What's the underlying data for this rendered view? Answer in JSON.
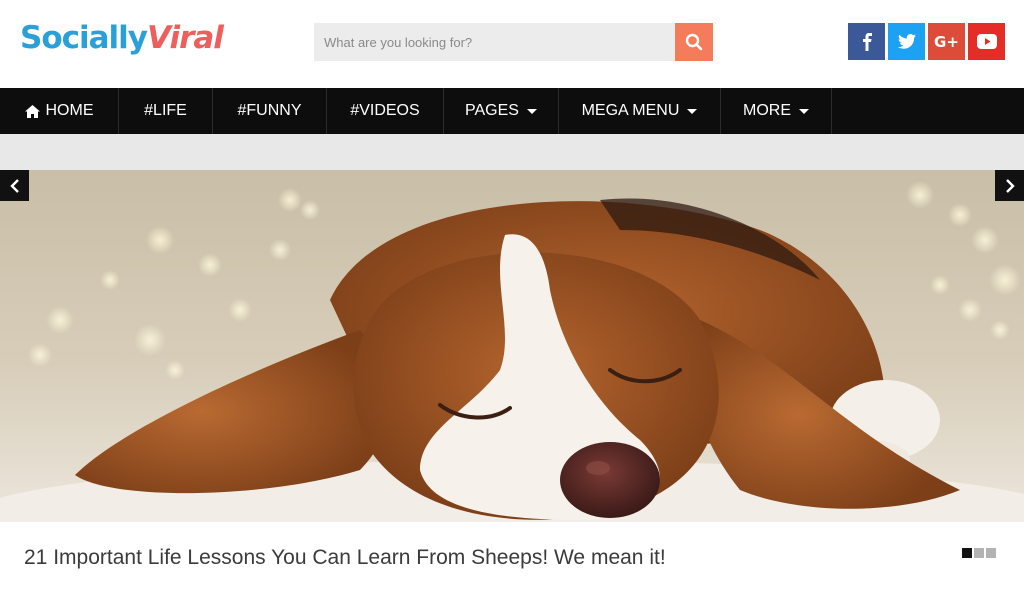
{
  "header": {
    "logo_part1": "Socially",
    "logo_part2": "Viral",
    "search": {
      "placeholder": "What are you looking for?",
      "value": ""
    },
    "social": [
      {
        "name": "facebook",
        "glyph": "f",
        "color": "#3b5998"
      },
      {
        "name": "twitter",
        "glyph": "t",
        "color": "#1da1f2"
      },
      {
        "name": "google-plus",
        "glyph": "G+",
        "color": "#dd4b39"
      },
      {
        "name": "youtube",
        "glyph": "▶",
        "color": "#e52d27"
      }
    ]
  },
  "nav": {
    "items": [
      {
        "label": "HOME",
        "icon": "home-icon"
      },
      {
        "label": "#LIFE"
      },
      {
        "label": "#FUNNY"
      },
      {
        "label": "#VIDEOS"
      },
      {
        "label": "PAGES",
        "dropdown": true
      },
      {
        "label": "MEGA MENU",
        "dropdown": true
      },
      {
        "label": "MORE",
        "dropdown": true
      }
    ]
  },
  "slider": {
    "image": "sleeping-beagle-puppy",
    "caption": "21 Important Life Lessons You Can Learn From Sheeps! We mean it!",
    "slide_count": 3,
    "active_slide": 1
  },
  "colors": {
    "brand_blue": "#2b9fd8",
    "brand_red": "#ec5f5c",
    "search_button": "#f47c5b",
    "nav_bg": "#0d0d0d"
  }
}
